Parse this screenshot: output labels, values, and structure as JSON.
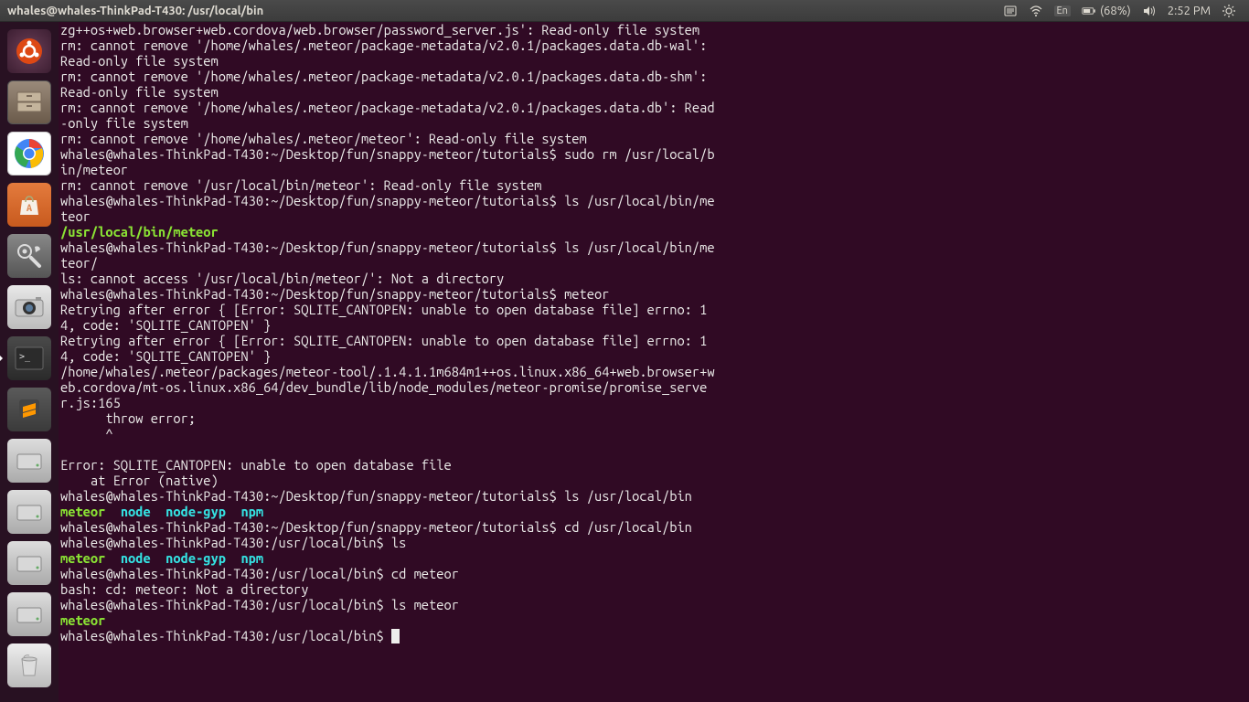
{
  "topbar": {
    "title": "whales@whales-ThinkPad-T430: /usr/local/bin",
    "lang": "En",
    "battery": "(68%)",
    "time": "2:52 PM"
  },
  "terminal_lines": [
    {
      "segs": [
        {
          "t": "zg++os+web.browser+web.cordova/web.browser/password_server.js': Read-only file system"
        }
      ]
    },
    {
      "segs": [
        {
          "t": "rm: cannot remove '/home/whales/.meteor/package-metadata/v2.0.1/packages.data.db-wal': Read-only file system"
        }
      ]
    },
    {
      "segs": [
        {
          "t": "rm: cannot remove '/home/whales/.meteor/package-metadata/v2.0.1/packages.data.db-shm': Read-only file system"
        }
      ]
    },
    {
      "segs": [
        {
          "t": "rm: cannot remove '/home/whales/.meteor/package-metadata/v2.0.1/packages.data.db': Read-only file system"
        }
      ]
    },
    {
      "segs": [
        {
          "t": "rm: cannot remove '/home/whales/.meteor/meteor': Read-only file system"
        }
      ]
    },
    {
      "segs": [
        {
          "t": "whales@whales-ThinkPad-T430:~/Desktop/fun/snappy-meteor/tutorials$ sudo rm /usr/local/bin/meteor"
        }
      ]
    },
    {
      "segs": [
        {
          "t": "rm: cannot remove '/usr/local/bin/meteor': Read-only file system"
        }
      ]
    },
    {
      "segs": [
        {
          "t": "whales@whales-ThinkPad-T430:~/Desktop/fun/snappy-meteor/tutorials$ ls /usr/local/bin/meteor"
        }
      ]
    },
    {
      "segs": [
        {
          "t": "/usr/local/bin/meteor",
          "c": "green"
        }
      ]
    },
    {
      "segs": [
        {
          "t": "whales@whales-ThinkPad-T430:~/Desktop/fun/snappy-meteor/tutorials$ ls /usr/local/bin/meteor/"
        }
      ]
    },
    {
      "segs": [
        {
          "t": "ls: cannot access '/usr/local/bin/meteor/': Not a directory"
        }
      ]
    },
    {
      "segs": [
        {
          "t": "whales@whales-ThinkPad-T430:~/Desktop/fun/snappy-meteor/tutorials$ meteor"
        }
      ]
    },
    {
      "segs": [
        {
          "t": "Retrying after error { [Error: SQLITE_CANTOPEN: unable to open database file] errno: 14, code: 'SQLITE_CANTOPEN' }"
        }
      ]
    },
    {
      "segs": [
        {
          "t": "Retrying after error { [Error: SQLITE_CANTOPEN: unable to open database file] errno: 14, code: 'SQLITE_CANTOPEN' }"
        }
      ]
    },
    {
      "segs": [
        {
          "t": "/home/whales/.meteor/packages/meteor-tool/.1.4.1.1m684m1++os.linux.x86_64+web.browser+web.cordova/mt-os.linux.x86_64/dev_bundle/lib/node_modules/meteor-promise/promise_server.js:165"
        }
      ]
    },
    {
      "segs": [
        {
          "t": "      throw error;"
        }
      ]
    },
    {
      "segs": [
        {
          "t": "      ^"
        }
      ]
    },
    {
      "segs": [
        {
          "t": " "
        }
      ]
    },
    {
      "segs": [
        {
          "t": "Error: SQLITE_CANTOPEN: unable to open database file"
        }
      ]
    },
    {
      "segs": [
        {
          "t": "    at Error (native)"
        }
      ]
    },
    {
      "segs": [
        {
          "t": "whales@whales-ThinkPad-T430:~/Desktop/fun/snappy-meteor/tutorials$ ls /usr/local/bin"
        }
      ]
    },
    {
      "segs": [
        {
          "t": "meteor",
          "c": "green"
        },
        {
          "t": "  "
        },
        {
          "t": "node",
          "c": "cyan"
        },
        {
          "t": "  "
        },
        {
          "t": "node-gyp",
          "c": "cyan"
        },
        {
          "t": "  "
        },
        {
          "t": "npm",
          "c": "cyan"
        }
      ]
    },
    {
      "segs": [
        {
          "t": "whales@whales-ThinkPad-T430:~/Desktop/fun/snappy-meteor/tutorials$ cd /usr/local/bin"
        }
      ]
    },
    {
      "segs": [
        {
          "t": "whales@whales-ThinkPad-T430:/usr/local/bin$ ls"
        }
      ]
    },
    {
      "segs": [
        {
          "t": "meteor",
          "c": "green"
        },
        {
          "t": "  "
        },
        {
          "t": "node",
          "c": "cyan"
        },
        {
          "t": "  "
        },
        {
          "t": "node-gyp",
          "c": "cyan"
        },
        {
          "t": "  "
        },
        {
          "t": "npm",
          "c": "cyan"
        }
      ]
    },
    {
      "segs": [
        {
          "t": "whales@whales-ThinkPad-T430:/usr/local/bin$ cd meteor"
        }
      ]
    },
    {
      "segs": [
        {
          "t": "bash: cd: meteor: Not a directory"
        }
      ]
    },
    {
      "segs": [
        {
          "t": "whales@whales-ThinkPad-T430:/usr/local/bin$ ls meteor"
        }
      ]
    },
    {
      "segs": [
        {
          "t": "meteor",
          "c": "green"
        }
      ]
    },
    {
      "segs": [
        {
          "t": "whales@whales-ThinkPad-T430:/usr/local/bin$ "
        }
      ],
      "cursor": true
    }
  ]
}
